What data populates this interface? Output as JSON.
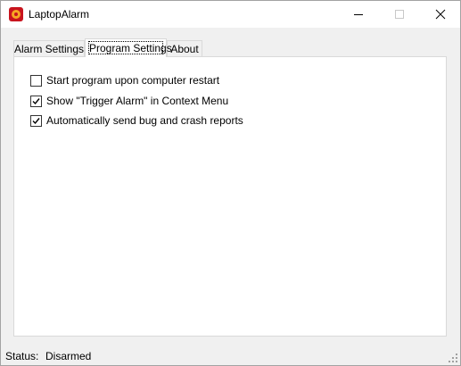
{
  "window": {
    "title": "LaptopAlarm",
    "icon": "alarm-app-icon",
    "controls": [
      "minimize-icon",
      "maximize-icon",
      "close-icon"
    ]
  },
  "tabs": [
    {
      "label": "Alarm Settings",
      "selected": false
    },
    {
      "label": "Program Settings",
      "selected": true
    },
    {
      "label": "About",
      "selected": false
    }
  ],
  "program_settings": {
    "options": [
      {
        "label": "Start program upon computer restart",
        "checked": false
      },
      {
        "label": "Show \"Trigger Alarm\" in Context Menu",
        "checked": true
      },
      {
        "label": "Automatically send bug and crash reports",
        "checked": true
      }
    ]
  },
  "status": {
    "label": "Status:",
    "value": "Disarmed"
  },
  "colors": {
    "app_icon_red": "#c8141e",
    "app_icon_orange": "#f6a623",
    "window_background": "#f0f0f0",
    "panel_background": "#ffffff"
  }
}
